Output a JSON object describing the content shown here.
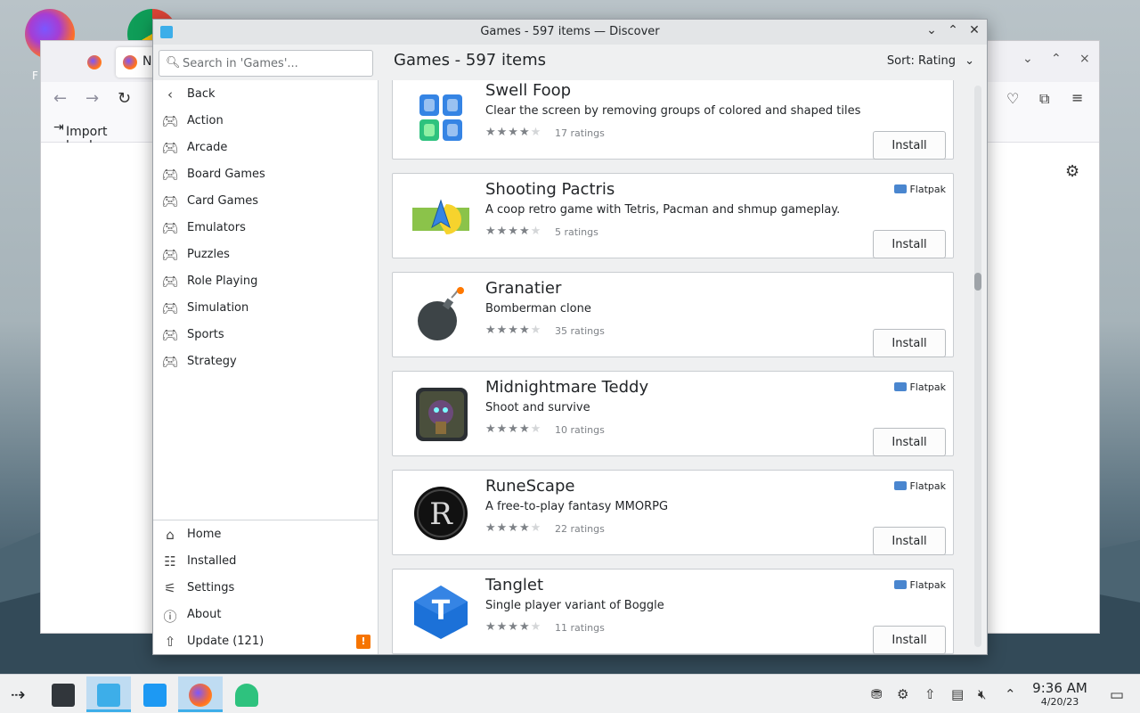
{
  "desktop": {
    "firefox_label": "F"
  },
  "firefox": {
    "tab_label": "N",
    "import_bookmarks": "Import bookma",
    "min_glyph": "⌄",
    "max_glyph": "⌃",
    "close_glyph": "×"
  },
  "discover": {
    "window_title": "Games - 597 items — Discover",
    "search_placeholder": "Search in 'Games'...",
    "page_title": "Games - 597 items",
    "sort_label": "Sort: Rating",
    "nav": {
      "back": "Back",
      "categories": [
        "Action",
        "Arcade",
        "Board Games",
        "Card Games",
        "Emulators",
        "Puzzles",
        "Role Playing",
        "Simulation",
        "Sports",
        "Strategy"
      ],
      "home": "Home",
      "installed": "Installed",
      "settings": "Settings",
      "about": "About",
      "update": "Update (121)",
      "update_badge": "!"
    },
    "apps": [
      {
        "name": "Swell Foop",
        "description": "Clear the screen by removing groups of colored and shaped tiles",
        "rating": 4,
        "ratings": "17 ratings",
        "source": "",
        "action": "Install"
      },
      {
        "name": "Shooting Pactris",
        "description": "A coop retro game with Tetris, Pacman and shmup gameplay.",
        "rating": 4,
        "ratings": "5 ratings",
        "source": "Flatpak",
        "action": "Install"
      },
      {
        "name": "Granatier",
        "description": "Bomberman clone",
        "rating": 4,
        "ratings": "35 ratings",
        "source": "",
        "action": "Install"
      },
      {
        "name": "Midnightmare Teddy",
        "description": "Shoot and survive",
        "rating": 4,
        "ratings": "10 ratings",
        "source": "Flatpak",
        "action": "Install"
      },
      {
        "name": "RuneScape",
        "description": "A free-to-play fantasy MMORPG",
        "rating": 4,
        "ratings": "22 ratings",
        "source": "Flatpak",
        "action": "Install"
      },
      {
        "name": "Tanglet",
        "description": "Single player variant of Boggle",
        "rating": 4,
        "ratings": "11 ratings",
        "source": "Flatpak",
        "action": "Install"
      }
    ]
  },
  "taskbar": {
    "time": "9:36 AM",
    "date": "4/20/23"
  },
  "colors": {
    "accent": "#3daee9",
    "warning": "#f67400"
  }
}
